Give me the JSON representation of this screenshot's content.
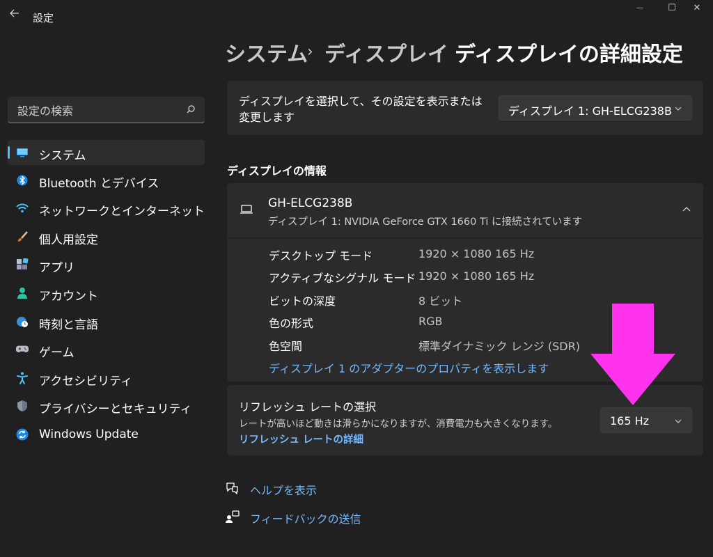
{
  "window": {
    "title": "設定",
    "controls": {
      "minimize": "—",
      "maximize": "☐",
      "close": "✕"
    }
  },
  "search": {
    "placeholder": "設定の検索"
  },
  "sidebar": {
    "items": [
      {
        "label": "システム",
        "icon": "monitor-icon",
        "active": true
      },
      {
        "label": "Bluetooth とデバイス",
        "icon": "bluetooth-icon"
      },
      {
        "label": "ネットワークとインターネット",
        "icon": "wifi-icon"
      },
      {
        "label": "個人用設定",
        "icon": "brush-icon"
      },
      {
        "label": "アプリ",
        "icon": "apps-icon"
      },
      {
        "label": "アカウント",
        "icon": "account-icon"
      },
      {
        "label": "時刻と言語",
        "icon": "globe-clock-icon"
      },
      {
        "label": "ゲーム",
        "icon": "gamepad-icon"
      },
      {
        "label": "アクセシビリティ",
        "icon": "accessibility-icon"
      },
      {
        "label": "プライバシーとセキュリティ",
        "icon": "shield-icon"
      },
      {
        "label": "Windows Update",
        "icon": "update-icon"
      }
    ]
  },
  "breadcrumb": {
    "items": [
      "システム",
      "ディスプレイ",
      "ディスプレイの詳細設定"
    ],
    "separator": "›"
  },
  "display_select": {
    "text": "ディスプレイを選択して、その設定を表示または変更します",
    "line1": "ディスプレイを選択して、その設定を表示または",
    "line2": "変更します",
    "value": "ディスプレイ 1: GH-ELCG238B"
  },
  "display_info": {
    "section_title": "ディスプレイの情報",
    "monitor_name": "GH-ELCG238B",
    "connection": "ディスプレイ 1: NVIDIA GeForce GTX 1660 Ti に接続されています",
    "rows": [
      {
        "label": "デスクトップ モード",
        "value": "1920 × 1080 165 Hz"
      },
      {
        "label": "アクティブなシグナル モード",
        "value": "1920 × 1080 165 Hz"
      },
      {
        "label": "ビットの深度",
        "value": "8 ビット"
      },
      {
        "label": "色の形式",
        "value": "RGB"
      },
      {
        "label": "色空間",
        "value": "標準ダイナミック レンジ (SDR)"
      }
    ],
    "adapter_link": "ディスプレイ 1 のアダプターのプロパティを表示します"
  },
  "refresh_rate": {
    "title": "リフレッシュ レートの選択",
    "description": "レートが高いほど動きは滑らかになりますが、消費電力も大きくなります。",
    "link": "リフレッシュ レートの詳細",
    "value": "165 Hz"
  },
  "footer_links": [
    {
      "label": "ヘルプを表示",
      "icon": "help-icon"
    },
    {
      "label": "フィードバックの送信",
      "icon": "feedback-icon"
    }
  ],
  "colors": {
    "background": "#202020",
    "card": "#2b2b2b",
    "accent": "#4cc2ff",
    "link": "#75b9ff",
    "annotation_arrow": "#ff33ee"
  }
}
